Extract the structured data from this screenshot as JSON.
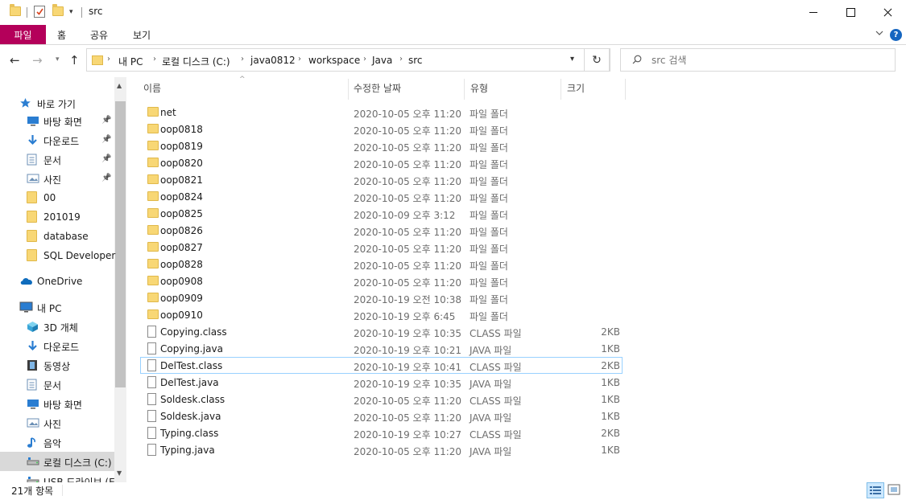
{
  "window": {
    "title": "src"
  },
  "ribbon": {
    "tabs": [
      "파일",
      "홈",
      "공유",
      "보기"
    ],
    "help": "?"
  },
  "address": {
    "crumbs": [
      "내 PC",
      "로컬 디스크 (C:)",
      "java0812",
      "workspace",
      "Java",
      "src"
    ]
  },
  "search": {
    "placeholder": "src 검색"
  },
  "sidebar": {
    "items": [
      {
        "label": "바로 가기",
        "icon": "star-icon",
        "indent": 0
      },
      {
        "label": "바탕 화면",
        "icon": "desktop-icon",
        "indent": 1,
        "pinned": true
      },
      {
        "label": "다운로드",
        "icon": "download-arrow-icon",
        "indent": 1,
        "pinned": true
      },
      {
        "label": "문서",
        "icon": "document-icon",
        "indent": 1,
        "pinned": true
      },
      {
        "label": "사진",
        "icon": "picture-icon",
        "indent": 1,
        "pinned": true
      },
      {
        "label": "00",
        "icon": "folder-icon",
        "indent": 1
      },
      {
        "label": "201019",
        "icon": "folder-icon",
        "indent": 1
      },
      {
        "label": "database",
        "icon": "folder-icon",
        "indent": 1
      },
      {
        "label": "SQL Developer",
        "icon": "folder-icon",
        "indent": 1
      },
      {
        "label": "OneDrive",
        "icon": "cloud-icon",
        "indent": 0
      },
      {
        "label": "내 PC",
        "icon": "computer-icon",
        "indent": 0
      },
      {
        "label": "3D 개체",
        "icon": "cube-icon",
        "indent": 1
      },
      {
        "label": "다운로드",
        "icon": "download-arrow-icon",
        "indent": 1
      },
      {
        "label": "동영상",
        "icon": "film-icon",
        "indent": 1
      },
      {
        "label": "문서",
        "icon": "document-icon",
        "indent": 1
      },
      {
        "label": "바탕 화면",
        "icon": "desktop-icon",
        "indent": 1
      },
      {
        "label": "사진",
        "icon": "picture-icon",
        "indent": 1
      },
      {
        "label": "음악",
        "icon": "music-note-icon",
        "indent": 1
      },
      {
        "label": "로컬 디스크 (C:)",
        "icon": "drive-icon",
        "indent": 1,
        "selected": true
      },
      {
        "label": "USB 드라이브 (E",
        "icon": "drive-icon",
        "indent": 1
      }
    ]
  },
  "columns": {
    "name": "이름",
    "date": "수정한 날짜",
    "type": "유형",
    "size": "크기"
  },
  "files": [
    {
      "name": "net",
      "date": "2020-10-05 오후 11:20",
      "type": "파일 폴더",
      "size": "",
      "kind": "folder"
    },
    {
      "name": "oop0818",
      "date": "2020-10-05 오후 11:20",
      "type": "파일 폴더",
      "size": "",
      "kind": "folder"
    },
    {
      "name": "oop0819",
      "date": "2020-10-05 오후 11:20",
      "type": "파일 폴더",
      "size": "",
      "kind": "folder"
    },
    {
      "name": "oop0820",
      "date": "2020-10-05 오후 11:20",
      "type": "파일 폴더",
      "size": "",
      "kind": "folder"
    },
    {
      "name": "oop0821",
      "date": "2020-10-05 오후 11:20",
      "type": "파일 폴더",
      "size": "",
      "kind": "folder"
    },
    {
      "name": "oop0824",
      "date": "2020-10-05 오후 11:20",
      "type": "파일 폴더",
      "size": "",
      "kind": "folder"
    },
    {
      "name": "oop0825",
      "date": "2020-10-09 오후 3:12",
      "type": "파일 폴더",
      "size": "",
      "kind": "folder"
    },
    {
      "name": "oop0826",
      "date": "2020-10-05 오후 11:20",
      "type": "파일 폴더",
      "size": "",
      "kind": "folder"
    },
    {
      "name": "oop0827",
      "date": "2020-10-05 오후 11:20",
      "type": "파일 폴더",
      "size": "",
      "kind": "folder"
    },
    {
      "name": "oop0828",
      "date": "2020-10-05 오후 11:20",
      "type": "파일 폴더",
      "size": "",
      "kind": "folder"
    },
    {
      "name": "oop0908",
      "date": "2020-10-05 오후 11:20",
      "type": "파일 폴더",
      "size": "",
      "kind": "folder"
    },
    {
      "name": "oop0909",
      "date": "2020-10-19 오전 10:38",
      "type": "파일 폴더",
      "size": "",
      "kind": "folder"
    },
    {
      "name": "oop0910",
      "date": "2020-10-19 오후 6:45",
      "type": "파일 폴더",
      "size": "",
      "kind": "folder"
    },
    {
      "name": "Copying.class",
      "date": "2020-10-19 오후 10:35",
      "type": "CLASS 파일",
      "size": "2KB",
      "kind": "file"
    },
    {
      "name": "Copying.java",
      "date": "2020-10-19 오후 10:21",
      "type": "JAVA 파일",
      "size": "1KB",
      "kind": "file"
    },
    {
      "name": "DelTest.class",
      "date": "2020-10-19 오후 10:41",
      "type": "CLASS 파일",
      "size": "2KB",
      "kind": "file",
      "focused": true
    },
    {
      "name": "DelTest.java",
      "date": "2020-10-19 오후 10:35",
      "type": "JAVA 파일",
      "size": "1KB",
      "kind": "file"
    },
    {
      "name": "Soldesk.class",
      "date": "2020-10-05 오후 11:20",
      "type": "CLASS 파일",
      "size": "1KB",
      "kind": "file"
    },
    {
      "name": "Soldesk.java",
      "date": "2020-10-05 오후 11:20",
      "type": "JAVA 파일",
      "size": "1KB",
      "kind": "file"
    },
    {
      "name": "Typing.class",
      "date": "2020-10-19 오후 10:27",
      "type": "CLASS 파일",
      "size": "2KB",
      "kind": "file"
    },
    {
      "name": "Typing.java",
      "date": "2020-10-05 오후 11:20",
      "type": "JAVA 파일",
      "size": "1KB",
      "kind": "file"
    }
  ],
  "status": {
    "count": "21개 항목"
  },
  "colors": {
    "file_tab": "#b4005a",
    "folder": "#f8d775",
    "focus_border": "#99d1ff",
    "help": "#1565c0"
  }
}
